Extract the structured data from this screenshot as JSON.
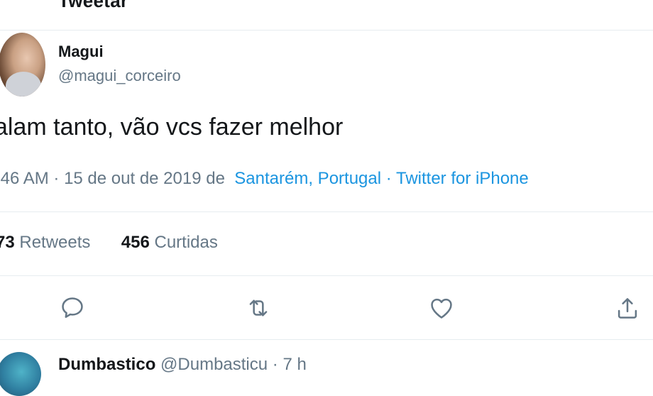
{
  "header": {
    "title": "Tweetar"
  },
  "tweet": {
    "author_name": "Magui",
    "author_handle": "@magui_corceiro",
    "text": "alam tanto, vão vcs fazer melhor",
    "time": ":46 AM",
    "date": "15 de out de 2019",
    "date_location_sep": "de",
    "location": "Santarém, Portugal",
    "client": "Twitter for iPhone",
    "dot": "·",
    "retweet_count": "73",
    "retweet_label": "Retweets",
    "like_count": "456",
    "like_label": "Curtidas"
  },
  "actions": {
    "reply_icon": "reply-icon",
    "retweet_icon": "retweet-icon",
    "like_icon": "heart-icon",
    "share_icon": "share-icon"
  },
  "reply": {
    "author_name": "Dumbastico",
    "author_handle": "@Dumbasticu",
    "time": "7 h",
    "dot": "·"
  },
  "colors": {
    "text": "#14171a",
    "secondary": "#657786",
    "link": "#1b95e0",
    "border": "#e6ecf0"
  }
}
